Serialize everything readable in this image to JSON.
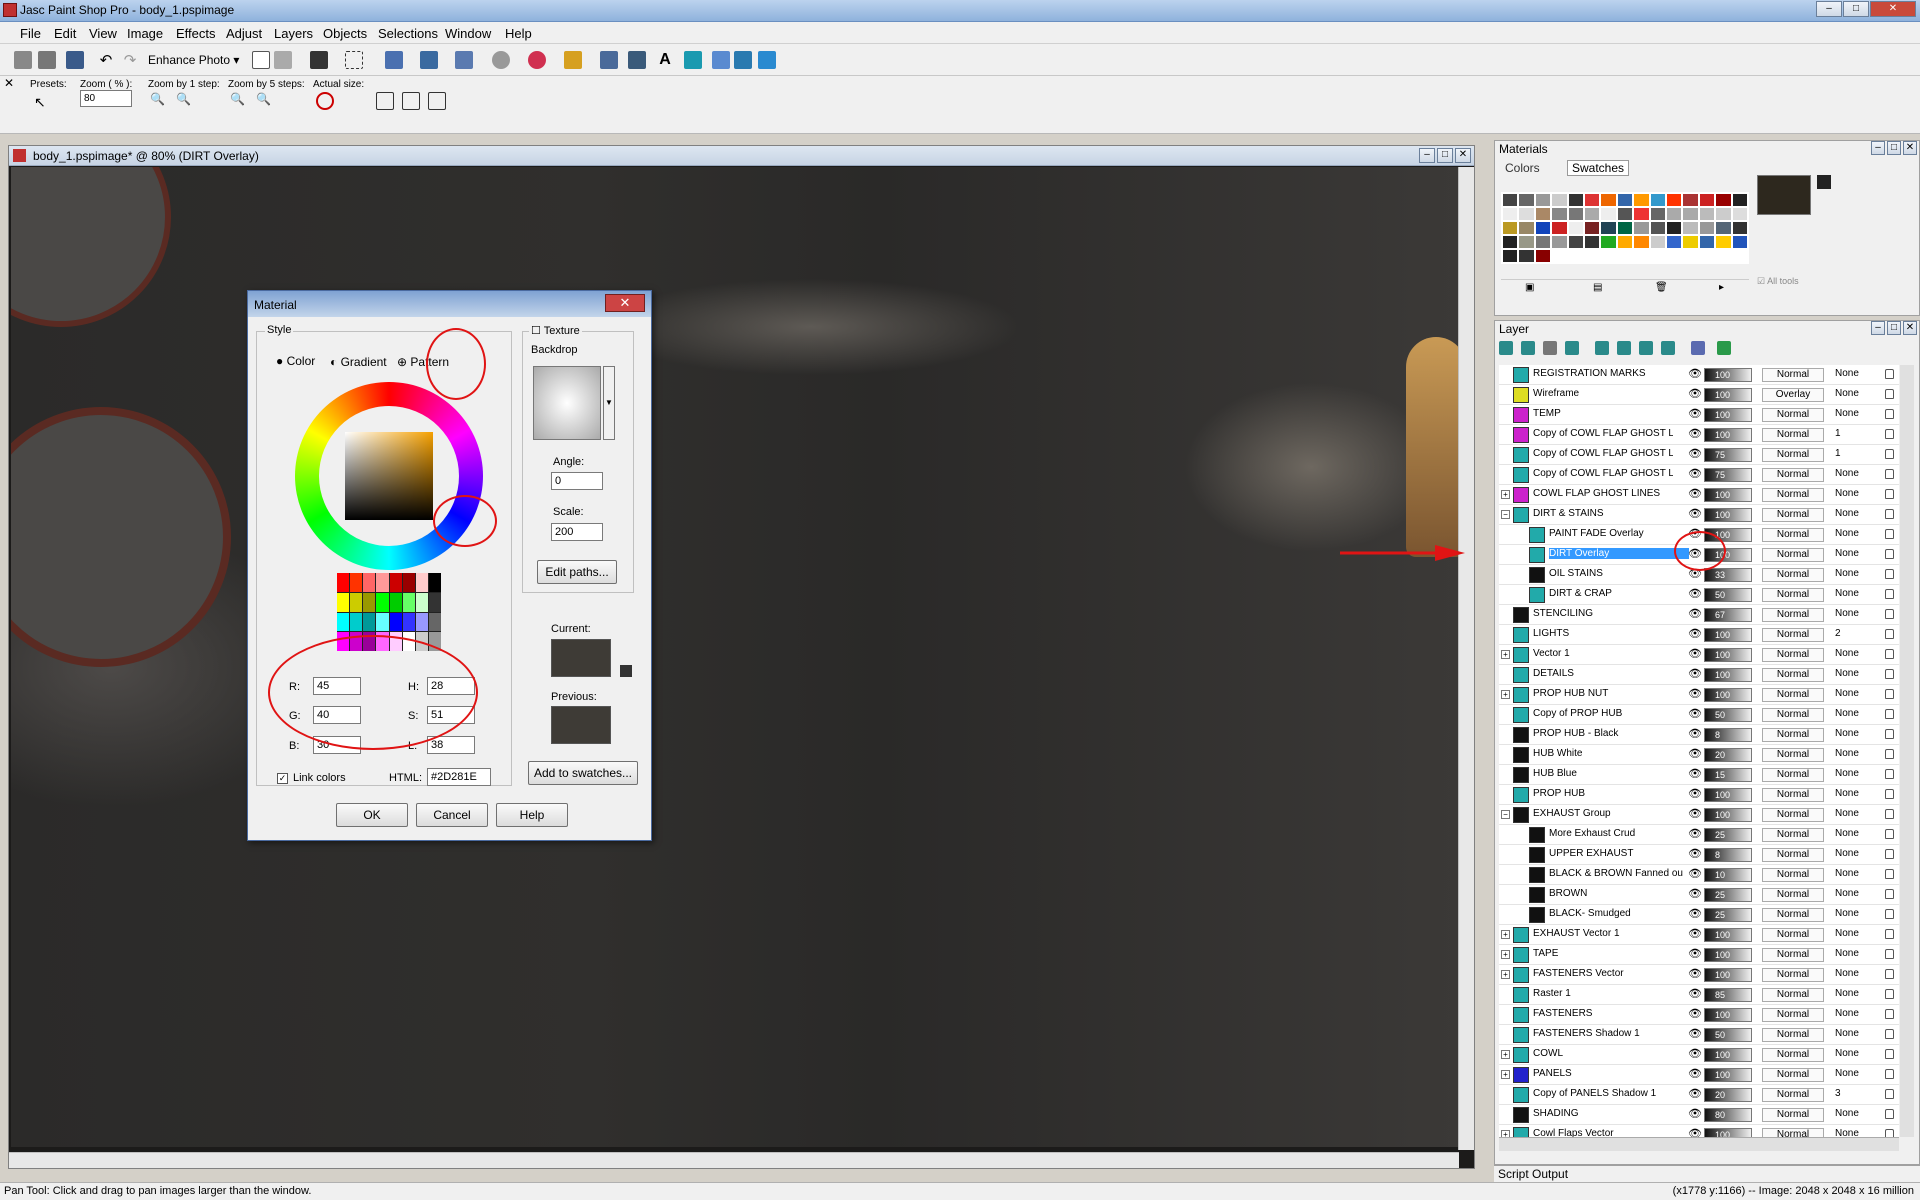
{
  "window": {
    "title": "Jasc Paint Shop Pro - body_1.pspimage"
  },
  "menu": [
    "File",
    "Edit",
    "View",
    "Image",
    "Effects",
    "Adjust",
    "Layers",
    "Objects",
    "Selections",
    "Window",
    "Help"
  ],
  "toolbar": {
    "enhance_photo": "Enhance Photo ▾"
  },
  "tool_options": {
    "presets": "Presets:",
    "zoom_label": "Zoom ( % ):",
    "zoom_value": "80",
    "zoom_by_1": "Zoom by 1 step:",
    "zoom_by_5": "Zoom by 5 steps:",
    "actual_size": "Actual size:"
  },
  "document": {
    "title": "body_1.pspimage* @ 80% (DIRT Overlay)"
  },
  "material_dialog": {
    "title": "Material",
    "style_label": "Style",
    "tabs": [
      "Color",
      "Gradient",
      "Pattern"
    ],
    "texture_label": "Texture",
    "backdrop_label": "Backdrop",
    "angle_label": "Angle:",
    "angle_value": "0",
    "scale_label": "Scale:",
    "scale_value": "200",
    "edit_paths": "Edit paths...",
    "current_label": "Current:",
    "previous_label": "Previous:",
    "r_label": "R:",
    "r_value": "45",
    "g_label": "G:",
    "g_value": "40",
    "b_label": "B:",
    "b_value": "30",
    "h_label": "H:",
    "h_value": "28",
    "s_label": "S:",
    "s_value": "51",
    "l_label": "L:",
    "l_value": "38",
    "link_colors": "Link colors",
    "html_label": "HTML:",
    "html_value": "#2D281E",
    "add_to_swatches": "Add to swatches...",
    "ok": "OK",
    "cancel": "Cancel",
    "help": "Help",
    "current_color": "#2D281E"
  },
  "materials_palette": {
    "title": "Materials",
    "tab_colors": "Colors",
    "tab_swatches": "Swatches",
    "all_tools": "All tools"
  },
  "layer_palette": {
    "title": "Layer",
    "layers": [
      {
        "name": "REGISTRATION MARKS",
        "opacity": "100",
        "blend": "Normal",
        "mask": "None",
        "thumb": "#2aa",
        "indent": 0,
        "exp": ""
      },
      {
        "name": "Wireframe",
        "opacity": "100",
        "blend": "Overlay",
        "mask": "None",
        "thumb": "#dd2",
        "indent": 0,
        "exp": ""
      },
      {
        "name": "TEMP",
        "opacity": "100",
        "blend": "Normal",
        "mask": "None",
        "thumb": "#c2c",
        "indent": 0,
        "exp": ""
      },
      {
        "name": "Copy of COWL FLAP GHOST LI",
        "opacity": "100",
        "blend": "Normal",
        "mask": "1",
        "thumb": "#c2c",
        "indent": 0,
        "exp": ""
      },
      {
        "name": "Copy of COWL FLAP GHOST LI",
        "opacity": "75",
        "blend": "Normal",
        "mask": "1",
        "thumb": "#2aa",
        "indent": 0,
        "exp": ""
      },
      {
        "name": "Copy of COWL FLAP GHOST LI",
        "opacity": "75",
        "blend": "Normal",
        "mask": "None",
        "thumb": "#2aa",
        "indent": 0,
        "exp": ""
      },
      {
        "name": "COWL FLAP GHOST LINES",
        "opacity": "100",
        "blend": "Normal",
        "mask": "None",
        "thumb": "#c2c",
        "indent": 0,
        "exp": "+"
      },
      {
        "name": "DIRT & STAINS",
        "opacity": "100",
        "blend": "Normal",
        "mask": "None",
        "thumb": "#2aa",
        "indent": 0,
        "exp": "−"
      },
      {
        "name": "PAINT FADE Overlay",
        "opacity": "100",
        "blend": "Normal",
        "mask": "None",
        "thumb": "#2aa",
        "indent": 1,
        "exp": ""
      },
      {
        "name": "DIRT Overlay",
        "opacity": "100",
        "blend": "Normal",
        "mask": "None",
        "thumb": "#2aa",
        "indent": 1,
        "exp": "",
        "sel": true
      },
      {
        "name": "OIL STAINS",
        "opacity": "33",
        "blend": "Normal",
        "mask": "None",
        "thumb": "#111",
        "indent": 1,
        "exp": ""
      },
      {
        "name": "DIRT & CRAP",
        "opacity": "50",
        "blend": "Normal",
        "mask": "None",
        "thumb": "#2aa",
        "indent": 1,
        "exp": ""
      },
      {
        "name": "STENCILING",
        "opacity": "67",
        "blend": "Normal",
        "mask": "None",
        "thumb": "#111",
        "indent": 0,
        "exp": ""
      },
      {
        "name": "LIGHTS",
        "opacity": "100",
        "blend": "Normal",
        "mask": "2",
        "thumb": "#2aa",
        "indent": 0,
        "exp": ""
      },
      {
        "name": "Vector 1",
        "opacity": "100",
        "blend": "Normal",
        "mask": "None",
        "thumb": "#2aa",
        "indent": 0,
        "exp": "+"
      },
      {
        "name": "DETAILS",
        "opacity": "100",
        "blend": "Normal",
        "mask": "None",
        "thumb": "#2aa",
        "indent": 0,
        "exp": ""
      },
      {
        "name": "PROP HUB NUT",
        "opacity": "100",
        "blend": "Normal",
        "mask": "None",
        "thumb": "#2aa",
        "indent": 0,
        "exp": "+"
      },
      {
        "name": "Copy of PROP HUB",
        "opacity": "50",
        "blend": "Normal",
        "mask": "None",
        "thumb": "#2aa",
        "indent": 0,
        "exp": ""
      },
      {
        "name": "PROP HUB - Black",
        "opacity": "8",
        "blend": "Normal",
        "mask": "None",
        "thumb": "#111",
        "indent": 0,
        "exp": ""
      },
      {
        "name": "HUB White",
        "opacity": "20",
        "blend": "Normal",
        "mask": "None",
        "thumb": "#111",
        "indent": 0,
        "exp": ""
      },
      {
        "name": "HUB Blue",
        "opacity": "15",
        "blend": "Normal",
        "mask": "None",
        "thumb": "#111",
        "indent": 0,
        "exp": ""
      },
      {
        "name": "PROP HUB",
        "opacity": "100",
        "blend": "Normal",
        "mask": "None",
        "thumb": "#2aa",
        "indent": 0,
        "exp": ""
      },
      {
        "name": "EXHAUST Group",
        "opacity": "100",
        "blend": "Normal",
        "mask": "None",
        "thumb": "#111",
        "indent": 0,
        "exp": "−"
      },
      {
        "name": "More Exhaust Crud",
        "opacity": "25",
        "blend": "Normal",
        "mask": "None",
        "thumb": "#111",
        "indent": 1,
        "exp": ""
      },
      {
        "name": "UPPER EXHAUST",
        "opacity": "8",
        "blend": "Normal",
        "mask": "None",
        "thumb": "#111",
        "indent": 1,
        "exp": ""
      },
      {
        "name": "BLACK & BROWN Fanned ou",
        "opacity": "10",
        "blend": "Normal",
        "mask": "None",
        "thumb": "#111",
        "indent": 1,
        "exp": ""
      },
      {
        "name": "BROWN",
        "opacity": "25",
        "blend": "Normal",
        "mask": "None",
        "thumb": "#111",
        "indent": 1,
        "exp": ""
      },
      {
        "name": "BLACK- Smudged",
        "opacity": "25",
        "blend": "Normal",
        "mask": "None",
        "thumb": "#111",
        "indent": 1,
        "exp": ""
      },
      {
        "name": "EXHAUST Vector 1",
        "opacity": "100",
        "blend": "Normal",
        "mask": "None",
        "thumb": "#2aa",
        "indent": 0,
        "exp": "+"
      },
      {
        "name": "TAPE",
        "opacity": "100",
        "blend": "Normal",
        "mask": "None",
        "thumb": "#2aa",
        "indent": 0,
        "exp": "+"
      },
      {
        "name": "FASTENERS Vector",
        "opacity": "100",
        "blend": "Normal",
        "mask": "None",
        "thumb": "#2aa",
        "indent": 0,
        "exp": "+"
      },
      {
        "name": "Raster 1",
        "opacity": "85",
        "blend": "Normal",
        "mask": "None",
        "thumb": "#2aa",
        "indent": 0,
        "exp": ""
      },
      {
        "name": "FASTENERS",
        "opacity": "100",
        "blend": "Normal",
        "mask": "None",
        "thumb": "#2aa",
        "indent": 0,
        "exp": ""
      },
      {
        "name": "FASTENERS Shadow 1",
        "opacity": "50",
        "blend": "Normal",
        "mask": "None",
        "thumb": "#2aa",
        "indent": 0,
        "exp": ""
      },
      {
        "name": "COWL",
        "opacity": "100",
        "blend": "Normal",
        "mask": "None",
        "thumb": "#2aa",
        "indent": 0,
        "exp": "+"
      },
      {
        "name": "PANELS",
        "opacity": "100",
        "blend": "Normal",
        "mask": "None",
        "thumb": "#22c",
        "indent": 0,
        "exp": "+"
      },
      {
        "name": "Copy of PANELS Shadow 1",
        "opacity": "20",
        "blend": "Normal",
        "mask": "3",
        "thumb": "#2aa",
        "indent": 0,
        "exp": ""
      },
      {
        "name": "SHADING",
        "opacity": "80",
        "blend": "Normal",
        "mask": "None",
        "thumb": "#111",
        "indent": 0,
        "exp": ""
      },
      {
        "name": "Cowl Flaps Vector",
        "opacity": "100",
        "blend": "Normal",
        "mask": "None",
        "thumb": "#2aa",
        "indent": 0,
        "exp": "+"
      }
    ]
  },
  "script_output": "Script Output",
  "status": {
    "left": "Pan Tool: Click and drag to pan images larger than the window.",
    "right": "(x1778 y:1166) -- Image:  2048 x 2048 x 16 million"
  }
}
